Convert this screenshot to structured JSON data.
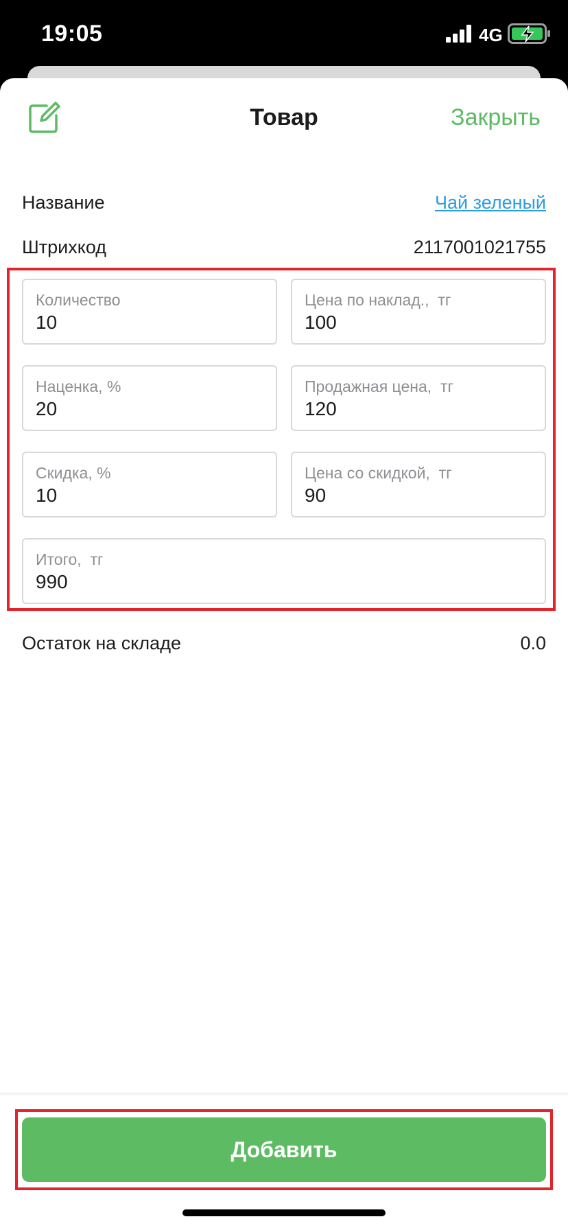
{
  "status_bar": {
    "time": "19:05",
    "network": "4G"
  },
  "header": {
    "title": "Товар",
    "close_label": "Закрыть",
    "accent_color": "#5dbb63"
  },
  "product": {
    "name_label": "Название",
    "name_value": "Чай зеленый",
    "barcode_label": "Штрихкод",
    "barcode_value": "2117001021755"
  },
  "fields": {
    "quantity": {
      "label": "Количество",
      "value": "10"
    },
    "invoice_price": {
      "label": "Цена по наклад.,  тг",
      "value": "100"
    },
    "markup": {
      "label": "Наценка, %",
      "value": "20"
    },
    "sale_price": {
      "label": "Продажная цена,  тг",
      "value": "120"
    },
    "discount": {
      "label": "Скидка, %",
      "value": "10"
    },
    "discounted_price": {
      "label": "Цена со скидкой,  тг",
      "value": "90"
    },
    "total": {
      "label": "Итого,  тг",
      "value": "990"
    }
  },
  "stock": {
    "label": "Остаток на складе",
    "value": "0.0"
  },
  "actions": {
    "add_label": "Добавить"
  },
  "colors": {
    "highlight": "#e3242b",
    "link": "#2d9ce0",
    "button": "#5dbb63"
  },
  "icons": {
    "edit": "edit-icon",
    "signal": "signal-icon",
    "battery": "battery-charging-icon"
  }
}
